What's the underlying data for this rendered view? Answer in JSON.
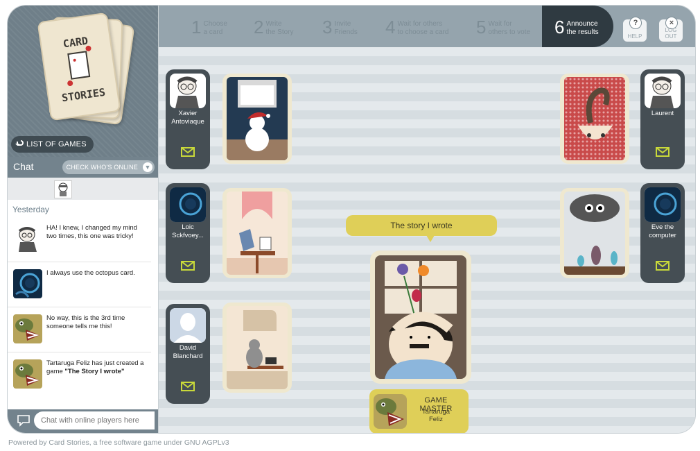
{
  "logo": {
    "line1": "CARD",
    "line2": "STORIES"
  },
  "left": {
    "list_games_label": "LIST OF GAMES"
  },
  "chat": {
    "title": "Chat",
    "who_online_label": "CHECK WHO'S ONLINE",
    "day_label": "Yesterday",
    "messages": [
      {
        "text": "HA! I knew, I changed my mind two times, this one was tricky!",
        "avatar": "boy-glasses"
      },
      {
        "text": "I always use the octopus card.",
        "avatar": "octopus"
      },
      {
        "text": "No way, this is the 3rd time someone tells me this!",
        "avatar": "turtle"
      },
      {
        "text_pre": "Tartaruga Feliz has just created a game ",
        "text_bold": "\"The Story I wrote\"",
        "avatar": "turtle"
      }
    ],
    "input_placeholder": "Chat with online players here"
  },
  "steps": [
    {
      "num": "1",
      "label1": "Choose",
      "label2": "a card"
    },
    {
      "num": "2",
      "label1": "Write",
      "label2": "the Story"
    },
    {
      "num": "3",
      "label1": "Invite",
      "label2": "Friends"
    },
    {
      "num": "4",
      "label1": "Wait for others",
      "label2": "to choose a card"
    },
    {
      "num": "5",
      "label1": "Wait for",
      "label2": "others to vote"
    },
    {
      "num": "6",
      "label1": "Announce",
      "label2": "the results"
    }
  ],
  "top_buttons": {
    "help": "HELP",
    "logout": "LOG OUT"
  },
  "players": [
    {
      "name1": "Xavier",
      "name2": "Antoviaque"
    },
    {
      "name1": "Loic",
      "name2": "Sckfvoey..."
    },
    {
      "name1": "David",
      "name2": "Blanchard"
    },
    {
      "name1": "Laurent",
      "name2": ""
    },
    {
      "name1": "Eve the",
      "name2": "computer"
    }
  ],
  "story_text": "The story I wrote",
  "game_master": {
    "title": "GAME MASTER",
    "name1": "Tartaruga",
    "name2": "Feliz"
  },
  "footer": "Powered by Card Stories, a free software game under GNU AGPLv3",
  "colors": {
    "accent_yellow": "#dfcf58",
    "dark_panel": "#454e54",
    "mail_green": "#c9d93a",
    "topbar": "#95a4ad"
  }
}
